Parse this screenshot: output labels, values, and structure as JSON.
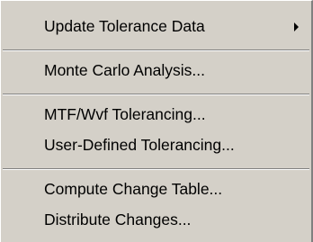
{
  "menu": {
    "items": [
      {
        "label": "Update Tolerance Data",
        "has_submenu": true
      },
      {
        "label": "Monte Carlo Analysis..."
      },
      {
        "label": "MTF/Wvf Tolerancing..."
      },
      {
        "label": "User-Defined Tolerancing..."
      },
      {
        "label": "Compute Change Table..."
      },
      {
        "label": "Distribute Changes..."
      }
    ]
  }
}
